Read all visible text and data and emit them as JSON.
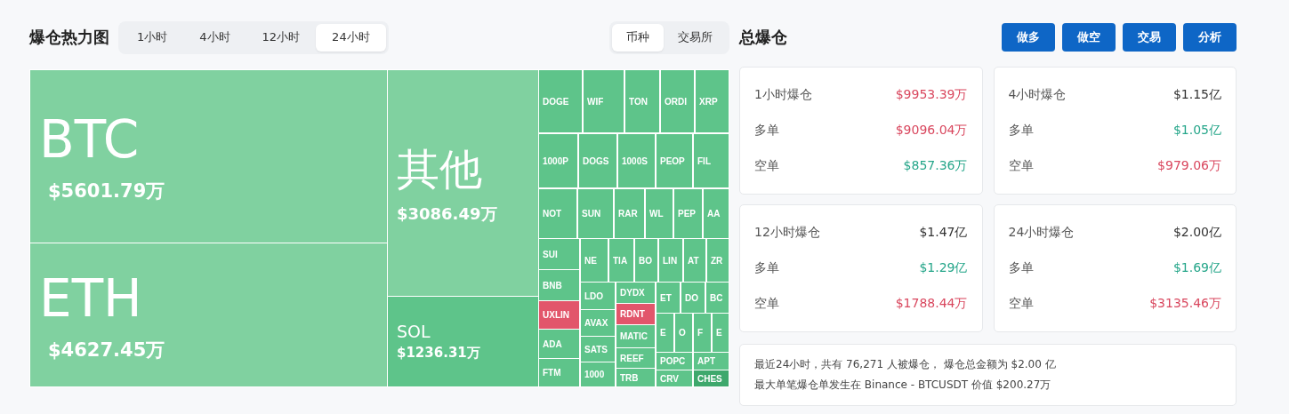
{
  "heatmap": {
    "title": "爆仓热力图",
    "periods": [
      {
        "label": "1小时",
        "selected": false
      },
      {
        "label": "4小时",
        "selected": false
      },
      {
        "label": "12小时",
        "selected": false
      },
      {
        "label": "24小时",
        "selected": true
      }
    ],
    "groupings": [
      {
        "label": "币种",
        "selected": true
      },
      {
        "label": "交易所",
        "selected": false
      }
    ],
    "tiles": [
      {
        "label": "BTC",
        "value": "$5601.79万",
        "color": "#80d1a0"
      },
      {
        "label": "ETH",
        "value": "$4627.45万",
        "color": "#80d1a0"
      },
      {
        "label": "其他",
        "value": "$3086.49万",
        "color": "#80d1a0"
      },
      {
        "label": "SOL",
        "value": "$1236.31万",
        "color": "#5ec48a"
      },
      {
        "label": "DOGE",
        "color": "#5ec48a"
      },
      {
        "label": "WIF",
        "color": "#5ec48a"
      },
      {
        "label": "TON",
        "color": "#5ec48a"
      },
      {
        "label": "ORDI",
        "color": "#5ec48a"
      },
      {
        "label": "XRP",
        "color": "#5ec48a"
      },
      {
        "label": "1000P",
        "color": "#5ec48a"
      },
      {
        "label": "DOGS",
        "color": "#5ec48a"
      },
      {
        "label": "1000S",
        "color": "#5ec48a"
      },
      {
        "label": "PEOP",
        "color": "#5ec48a"
      },
      {
        "label": "FIL",
        "color": "#5ec48a"
      },
      {
        "label": "NOT",
        "color": "#5ec48a"
      },
      {
        "label": "SUN",
        "color": "#5ec48a"
      },
      {
        "label": "RAR",
        "color": "#5ec48a"
      },
      {
        "label": "WL",
        "color": "#5ec48a"
      },
      {
        "label": "PEP",
        "color": "#5ec48a"
      },
      {
        "label": "AA",
        "color": "#5ec48a"
      },
      {
        "label": "SUI",
        "color": "#5ec48a"
      },
      {
        "label": "BNB",
        "color": "#5ec48a"
      },
      {
        "label": "UXLIN",
        "color": "#e2566b"
      },
      {
        "label": "ADA",
        "color": "#5ec48a"
      },
      {
        "label": "FTM",
        "color": "#5ec48a"
      },
      {
        "label": "NE",
        "color": "#5ec48a"
      },
      {
        "label": "TIA",
        "color": "#5ec48a"
      },
      {
        "label": "BO",
        "color": "#5ec48a"
      },
      {
        "label": "LIN",
        "color": "#5ec48a"
      },
      {
        "label": "AT",
        "color": "#5ec48a"
      },
      {
        "label": "ZR",
        "color": "#5ec48a"
      },
      {
        "label": "LDO",
        "color": "#5ec48a"
      },
      {
        "label": "AVAX",
        "color": "#5ec48a"
      },
      {
        "label": "SATS",
        "color": "#5ec48a"
      },
      {
        "label": "1000",
        "color": "#5ec48a"
      },
      {
        "label": "DYDX",
        "color": "#5ec48a"
      },
      {
        "label": "RDNT",
        "color": "#e2566b"
      },
      {
        "label": "MATIC",
        "color": "#5ec48a"
      },
      {
        "label": "REEF",
        "color": "#5ec48a"
      },
      {
        "label": "TRB",
        "color": "#5ec48a"
      },
      {
        "label": "ET",
        "color": "#5ec48a"
      },
      {
        "label": "DO",
        "color": "#5ec48a"
      },
      {
        "label": "BC",
        "color": "#5ec48a"
      },
      {
        "label": "E",
        "color": "#5ec48a"
      },
      {
        "label": "O",
        "color": "#5ec48a"
      },
      {
        "label": "F",
        "color": "#5ec48a"
      },
      {
        "label": "E",
        "color": "#5ec48a"
      },
      {
        "label": "POPC",
        "color": "#5ec48a"
      },
      {
        "label": "APT",
        "color": "#5ec48a"
      },
      {
        "label": "CRV",
        "color": "#5ec48a"
      },
      {
        "label": "CHES",
        "color": "#3ea86c"
      }
    ]
  },
  "totals": {
    "title": "总爆仓",
    "buttons": [
      "做多",
      "做空",
      "交易",
      "分析"
    ],
    "cards": [
      {
        "rows": [
          {
            "label": "1小时爆仓",
            "value": "$9953.39万",
            "color": "#d9475e"
          },
          {
            "label": "多单",
            "value": "$9096.04万",
            "color": "#d9475e"
          },
          {
            "label": "空单",
            "value": "$857.36万",
            "color": "#26a68a"
          }
        ]
      },
      {
        "rows": [
          {
            "label": "4小时爆仓",
            "value": "$1.15亿",
            "color": "#333333"
          },
          {
            "label": "多单",
            "value": "$1.05亿",
            "color": "#26a68a"
          },
          {
            "label": "空单",
            "value": "$979.06万",
            "color": "#d9475e"
          }
        ]
      },
      {
        "rows": [
          {
            "label": "12小时爆仓",
            "value": "$1.47亿",
            "color": "#333333"
          },
          {
            "label": "多单",
            "value": "$1.29亿",
            "color": "#26a68a"
          },
          {
            "label": "空单",
            "value": "$1788.44万",
            "color": "#d9475e"
          }
        ]
      },
      {
        "rows": [
          {
            "label": "24小时爆仓",
            "value": "$2.00亿",
            "color": "#333333"
          },
          {
            "label": "多单",
            "value": "$1.69亿",
            "color": "#26a68a"
          },
          {
            "label": "空单",
            "value": "$3135.46万",
            "color": "#d9475e"
          }
        ]
      }
    ],
    "summary": [
      "最近24小时，共有 76,271 人被爆仓， 爆仓总金额为 $2.00 亿",
      "最大单笔爆仓单发生在 Binance - BTCUSDT 价值 $200.27万"
    ]
  }
}
